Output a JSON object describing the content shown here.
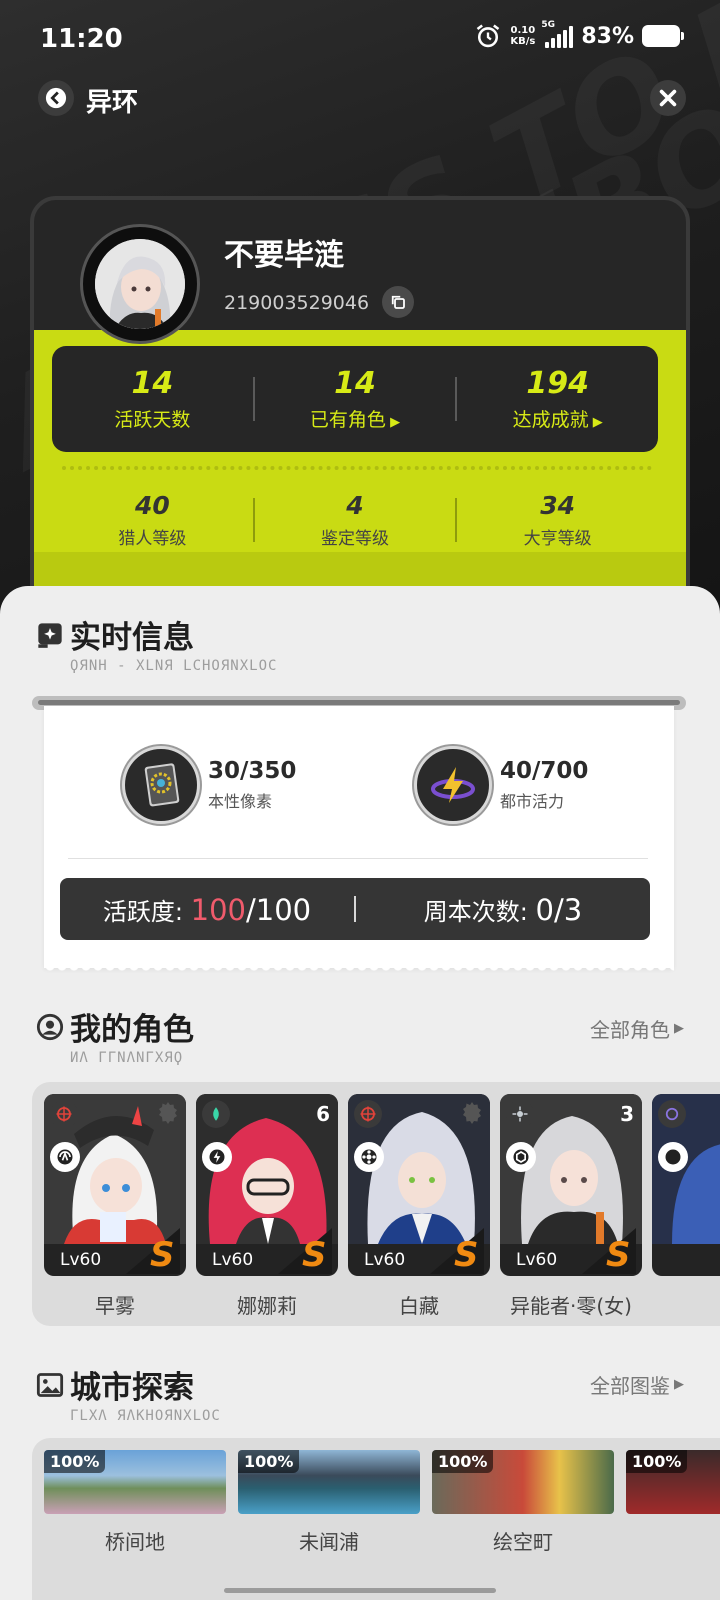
{
  "status_bar": {
    "time": "11:20",
    "net_speed_value": "0.10",
    "net_speed_unit": "KB/s",
    "network_type": "5G",
    "battery": "83%",
    "icons": [
      "alarm-icon",
      "signal-icon",
      "battery-icon"
    ]
  },
  "nav": {
    "title": "异环",
    "back_icon": "chevron-left-icon",
    "close_icon": "close-icon"
  },
  "profile": {
    "name": "不要毕涟",
    "uid": "219003529046",
    "stats": [
      {
        "value": "14",
        "label": "活跃天数"
      },
      {
        "value": "14",
        "label": "已有角色"
      },
      {
        "value": "194",
        "label": "达成成就"
      }
    ],
    "levels": [
      {
        "value": "40",
        "label": "猎人等级"
      },
      {
        "value": "4",
        "label": "鉴定等级"
      },
      {
        "value": "34",
        "label": "大亨等级"
      }
    ],
    "accent_color": "#c9db13"
  },
  "realtime": {
    "title": "实时信息",
    "subtitle": "ϘЯNH - XLNЯ LCHOЯNXLOC",
    "resources": [
      {
        "value": "30/350",
        "label": "本性像素"
      },
      {
        "value": "40/700",
        "label": "都市活力"
      }
    ],
    "activity_label": "活跃度:",
    "activity_current": "100",
    "activity_total": "/100",
    "weekly_label": "周本次数:",
    "weekly_value": "0/3"
  },
  "characters": {
    "title": "我的角色",
    "subtitle": "ИΛ ΓΓΝΛΝΓΧЯϘ",
    "more": "全部角色",
    "items": [
      {
        "name": "早雾",
        "level": "Lv60",
        "rank": "S",
        "constellation": ""
      },
      {
        "name": "娜娜莉",
        "level": "Lv60",
        "rank": "S",
        "constellation": "6"
      },
      {
        "name": "白藏",
        "level": "Lv60",
        "rank": "S",
        "constellation": ""
      },
      {
        "name": "异能者·零(女)",
        "level": "Lv60",
        "rank": "S",
        "constellation": "3"
      }
    ]
  },
  "city": {
    "title": "城市探索",
    "subtitle": "ΓLXΛ ЯΛKHOЯNXLOC",
    "more": "全部图鉴",
    "items": [
      {
        "name": "桥间地",
        "progress": "100%"
      },
      {
        "name": "未闻浦",
        "progress": "100%"
      },
      {
        "name": "绘空町",
        "progress": "100%"
      },
      {
        "name": "",
        "progress": "100%"
      }
    ]
  }
}
